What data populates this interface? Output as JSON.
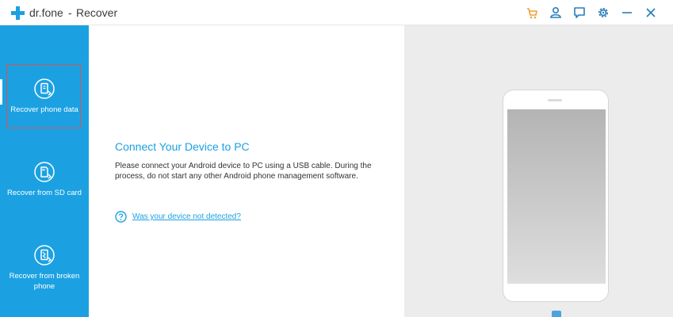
{
  "window": {
    "brand": "dr.fone",
    "separator": "-",
    "title": "Recover",
    "controls": [
      {
        "name": "cart-icon"
      },
      {
        "name": "user-icon"
      },
      {
        "name": "feedback-icon"
      },
      {
        "name": "settings-icon"
      },
      {
        "name": "minimize-icon"
      },
      {
        "name": "close-icon"
      }
    ]
  },
  "colors": {
    "accent": "#1ba1e2",
    "cart": "#f0a030",
    "active_outline": "#d9534f"
  },
  "sidebar": {
    "items": [
      {
        "label": "Recover phone data",
        "icon": "phone-recover-icon",
        "active": true
      },
      {
        "label": "Recover from SD card",
        "icon": "sd-card-icon",
        "active": false
      },
      {
        "label": "Recover from broken phone",
        "icon": "broken-phone-icon",
        "active": false
      }
    ]
  },
  "main": {
    "heading": "Connect Your Device to PC",
    "description": "Please connect your Android device to PC using a USB cable. During the process, do not start any other Android phone management software.",
    "help_link": "Was your device not detected?",
    "help_icon": "question-circle-icon"
  }
}
